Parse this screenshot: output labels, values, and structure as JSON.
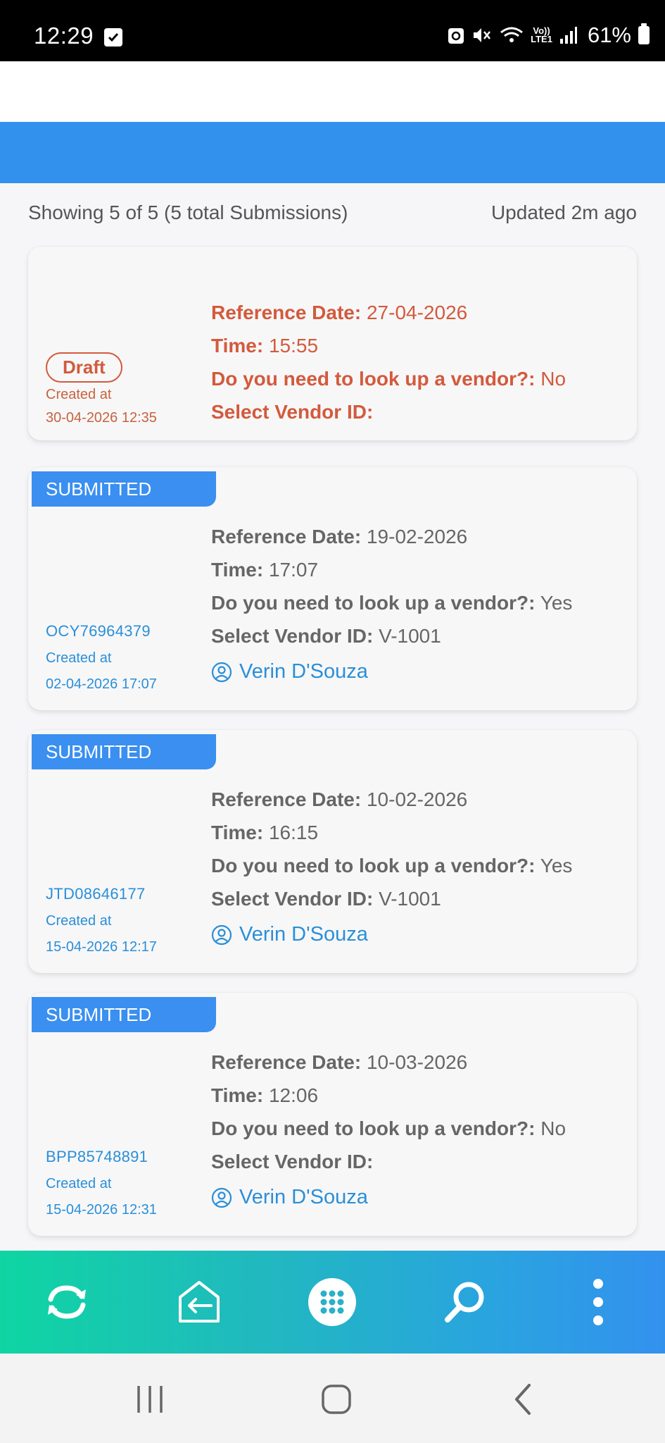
{
  "status_bar": {
    "time": "12:29",
    "lte_top": "Vo))",
    "lte_bottom": "LTE1",
    "battery": "61%"
  },
  "summary": {
    "showing": "Showing 5 of 5 (5 total Submissions)",
    "updated": "Updated 2m ago"
  },
  "labels": {
    "reference_date": "Reference Date:",
    "time": "Time:",
    "vendor_question": "Do you need to look up a vendor?:",
    "select_vendor": "Select Vendor ID:",
    "created_at": "Created at"
  },
  "cards": [
    {
      "status": "Draft",
      "created_at": "30-04-2026 12:35",
      "reference_date": "27-04-2026",
      "time": "15:55",
      "vendor_lookup": "No",
      "vendor_id": ""
    },
    {
      "status": "SUBMITTED",
      "id": "OCY76964379",
      "created_at": "02-04-2026 17:07",
      "reference_date": "19-02-2026",
      "time": "17:07",
      "vendor_lookup": "Yes",
      "vendor_id": "V-1001",
      "user": "Verin D'Souza"
    },
    {
      "status": "SUBMITTED",
      "id": "JTD08646177",
      "created_at": "15-04-2026 12:17",
      "reference_date": "10-02-2026",
      "time": "16:15",
      "vendor_lookup": "Yes",
      "vendor_id": "V-1001",
      "user": "Verin D'Souza"
    },
    {
      "status": "SUBMITTED",
      "id": "BPP85748891",
      "created_at": "15-04-2026 12:31",
      "reference_date": "10-03-2026",
      "time": "12:06",
      "vendor_lookup": "No",
      "vendor_id": "",
      "user": "Verin D'Souza"
    }
  ],
  "toolbar": {
    "icons": [
      "sync-icon",
      "exit-icon",
      "apps-grid-icon",
      "search-icon",
      "more-vertical-icon"
    ]
  },
  "nav_bar": {
    "icons": [
      "recents-icon",
      "home-icon",
      "back-icon"
    ]
  },
  "colors": {
    "primary_blue": "#3391ee",
    "draft_red": "#d35a3c",
    "link_blue": "#2a8fd8",
    "toolbar_gradient_start": "#0fd5a2"
  }
}
